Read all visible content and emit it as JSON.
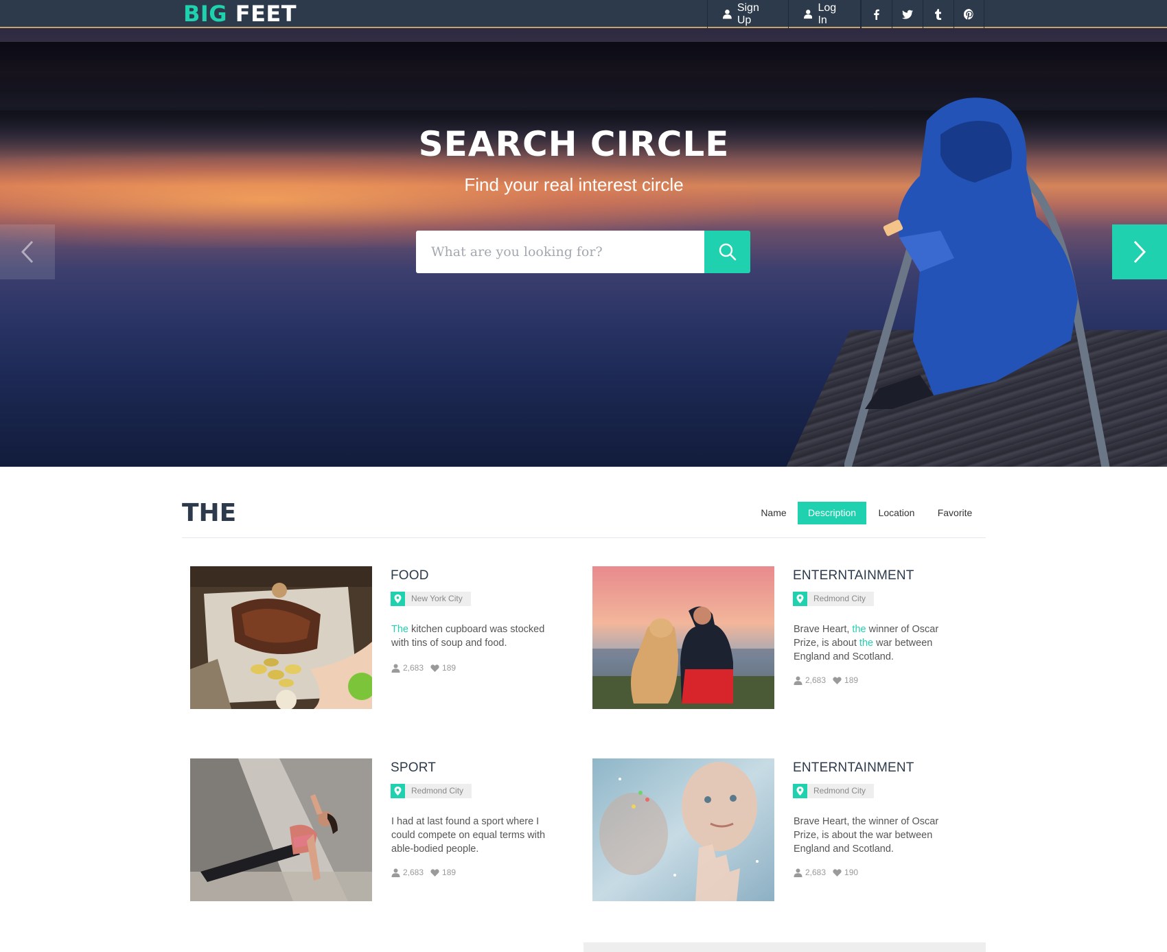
{
  "topbar": {
    "logo_big": "BIG",
    "logo_feet": "FEET",
    "signup_label": "Sign Up",
    "login_label": "Log In",
    "social": [
      "facebook-icon",
      "twitter-icon",
      "tumblr-icon",
      "pinterest-icon"
    ]
  },
  "hero": {
    "title": "SEARCH CIRCLE",
    "subtitle": "Find your real interest circle",
    "search_placeholder": "What are you looking for?"
  },
  "section": {
    "title": "THE",
    "tabs": [
      "Name",
      "Description",
      "Location",
      "Favorite"
    ],
    "active_tab": "Description"
  },
  "cards": [
    {
      "title": "FOOD",
      "location": "New York City",
      "desc_parts": [
        "The",
        " kitchen cupboard was stocked with tins of soup and food."
      ],
      "members": "2,683",
      "likes": "189"
    },
    {
      "title": "ENTERNTAINMENT",
      "location": "Redmond City",
      "desc_parts": [
        "Brave Heart, ",
        "the",
        " winner of Oscar Prize, is about ",
        "the",
        " war between England and Scotland."
      ],
      "members": "2,683",
      "likes": "189"
    },
    {
      "title": "SPORT",
      "location": "Redmond City",
      "description": "I had at last found a sport where I could compete on equal terms with able-bodied people.",
      "members": "2,683",
      "likes": "189"
    },
    {
      "title": "ENTERNTAINMENT",
      "location": "Redmond City",
      "description": "Brave Heart, the winner of Oscar Prize, is about the war between England and Scotland.",
      "members": "2,683",
      "likes": "190"
    }
  ],
  "colors": {
    "accent": "#1fd1ae",
    "topbar": "#2c3a4b",
    "heading": "#2c3a4b"
  }
}
